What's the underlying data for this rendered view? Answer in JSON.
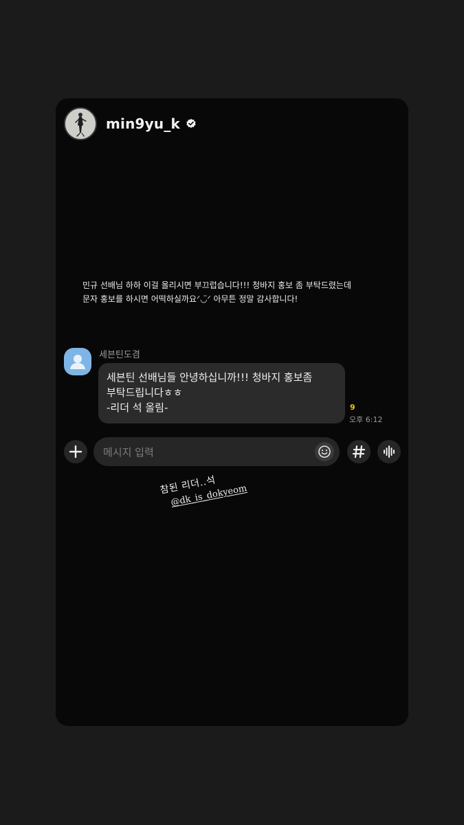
{
  "story": {
    "username": "min9yu_k",
    "verified_icon": "verified-badge-icon",
    "caption": "민규 선배님 하하 이걸 올리시면 부끄럽습니다!!! 청바지 홍보 좀 부탁드렸는데\n문자 홍보를 하시면 어떡하실까요ᐟ◡̈ᐟ 아무튼 정말 감사합니다!",
    "handwritten_line1": "참된 리더..석",
    "mention": "@dk_is_dokyeom"
  },
  "chat": {
    "sender_name": "세븐틴도겸",
    "message_lines": [
      "세븐틴 선배님들 안녕하십니까!!! 청바지 홍보좀",
      "부탁드립니다ㅎㅎ",
      "-리더 석 올림-"
    ],
    "unread_count": "9",
    "time": "오후 6:12"
  },
  "input_bar": {
    "placeholder": "메시지 입력",
    "plus_icon": "plus-icon",
    "emoji_icon": "emoji-icon",
    "hashtag_icon": "hashtag-icon",
    "voice_icon": "voice-wave-icon"
  },
  "colors": {
    "background": "#1b1b1b",
    "card": "#080808",
    "bubble": "#2b2b2b",
    "unread": "#f4c700",
    "sender_avatar": "#7fb5e6"
  }
}
